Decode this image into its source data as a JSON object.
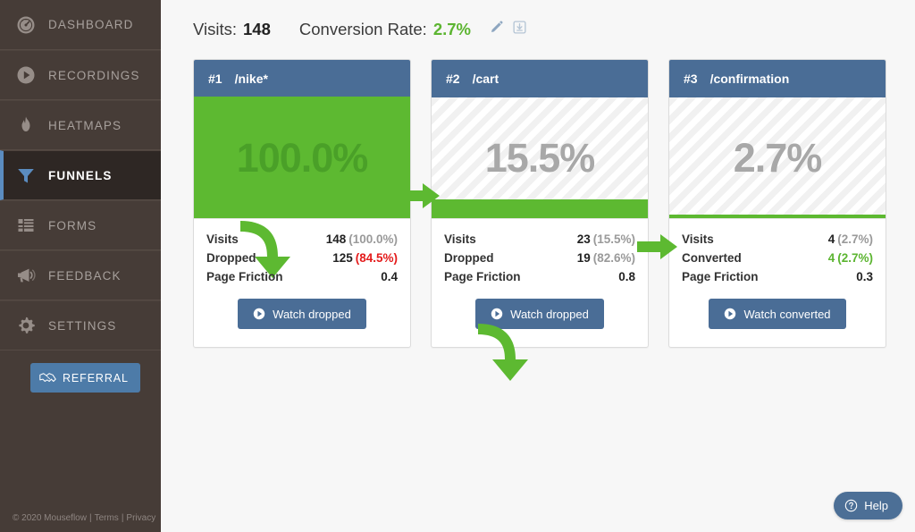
{
  "sidebar": {
    "items": [
      {
        "label": "DASHBOARD",
        "icon": "gauge-icon",
        "active": false
      },
      {
        "label": "RECORDINGS",
        "icon": "play-circle-icon",
        "active": false
      },
      {
        "label": "HEATMAPS",
        "icon": "flame-icon",
        "active": false
      },
      {
        "label": "FUNNELS",
        "icon": "funnel-icon",
        "active": true
      },
      {
        "label": "FORMS",
        "icon": "form-list-icon",
        "active": false
      },
      {
        "label": "FEEDBACK",
        "icon": "megaphone-icon",
        "active": false
      },
      {
        "label": "SETTINGS",
        "icon": "gear-icon",
        "active": false
      }
    ],
    "referral": {
      "label": "REFERRAL",
      "icon": "handshake-icon"
    },
    "footer": {
      "copyright": "© 2020 Mouseflow",
      "terms": "Terms",
      "privacy": "Privacy",
      "sep": "|"
    }
  },
  "topbar": {
    "visits_label": "Visits:",
    "visits_value": "148",
    "conversion_label": "Conversion Rate:",
    "conversion_value": "2.7%",
    "edit_icon": "pencil-icon",
    "save_icon": "save-icon"
  },
  "colors": {
    "green": "#5db931",
    "green_text": "#5cb531",
    "red": "#e41b1b",
    "blue_header": "#4a6d96",
    "grey_text": "#9a9a9a",
    "sidebar_bg": "#463c37",
    "sidebar_active_bg": "#2e2724",
    "accent_blue": "#5b8cc0"
  },
  "funnel": {
    "steps": [
      {
        "number": "#1",
        "url": "/nike*",
        "percent": "100.0%",
        "fill_height_pct": 100,
        "full": true,
        "rows": [
          {
            "name": "Visits",
            "value": "148",
            "pct": "(100.0%)",
            "pct_style": "grey",
            "value_style": "plain"
          },
          {
            "name": "Dropped",
            "value": "125",
            "pct": "(84.5%)",
            "pct_style": "red",
            "value_style": "plain"
          },
          {
            "name": "Page Friction",
            "value": "0.4",
            "pct": "",
            "pct_style": "none",
            "value_style": "plain"
          }
        ],
        "button": {
          "label": "Watch dropped",
          "icon": "play-circle-icon"
        },
        "show_drop_arrow": true,
        "show_connector": true
      },
      {
        "number": "#2",
        "url": "/cart",
        "percent": "15.5%",
        "fill_height_pct": 15.5,
        "full": false,
        "rows": [
          {
            "name": "Visits",
            "value": "23",
            "pct": "(15.5%)",
            "pct_style": "grey",
            "value_style": "plain"
          },
          {
            "name": "Dropped",
            "value": "19",
            "pct": "(82.6%)",
            "pct_style": "grey",
            "value_style": "plain"
          },
          {
            "name": "Page Friction",
            "value": "0.8",
            "pct": "",
            "pct_style": "none",
            "value_style": "plain"
          }
        ],
        "button": {
          "label": "Watch dropped",
          "icon": "play-circle-icon"
        },
        "show_drop_arrow": true,
        "show_connector": true
      },
      {
        "number": "#3",
        "url": "/confirmation",
        "percent": "2.7%",
        "fill_height_pct": 2.7,
        "full": false,
        "rows": [
          {
            "name": "Visits",
            "value": "4",
            "pct": "(2.7%)",
            "pct_style": "grey",
            "value_style": "plain"
          },
          {
            "name": "Converted",
            "value": "4",
            "pct": "(2.7%)",
            "pct_style": "green",
            "value_style": "green-num"
          },
          {
            "name": "Page Friction",
            "value": "0.3",
            "pct": "",
            "pct_style": "none",
            "value_style": "plain"
          }
        ],
        "button": {
          "label": "Watch converted",
          "icon": "play-circle-icon"
        },
        "show_drop_arrow": false,
        "show_connector": false
      }
    ]
  },
  "help": {
    "label": "Help",
    "icon": "question-circle-icon"
  }
}
